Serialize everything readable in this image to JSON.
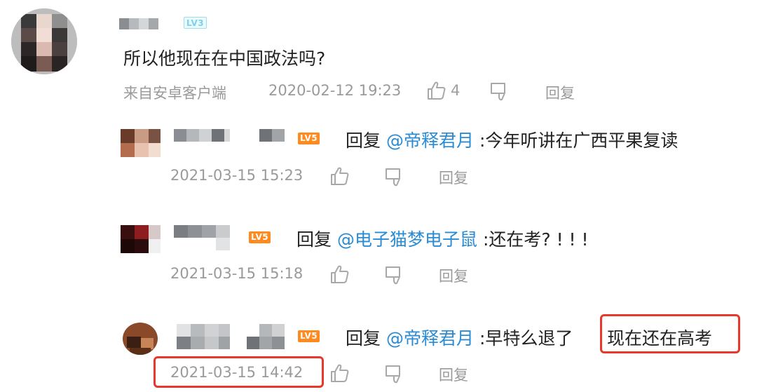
{
  "main_comment": {
    "level_badge": "LV3",
    "text": "所以他现在在中国政法吗?",
    "source": "来自安卓客户端",
    "time": "2020-02-12 19:23",
    "likes": "4",
    "reply_label": "回复"
  },
  "replies": [
    {
      "level_badge": "LV5",
      "reply_word": "回复",
      "mention": "@帝释君月",
      "text": ":今年听讲在广西平果复读",
      "time": "2021-03-15 15:23",
      "reply_label": "回复"
    },
    {
      "level_badge": "LV5",
      "reply_word": "回复",
      "mention": "@电子猫梦电子鼠",
      "text": ":还在考? ! ! !",
      "time": "2021-03-15 15:18",
      "reply_label": "回复"
    },
    {
      "level_badge": "LV5",
      "reply_word": "回复",
      "mention": "@帝释君月",
      "text_before": ":早特么退了",
      "text_highlight": "现在还在高考",
      "time": "2021-03-15 14:42",
      "reply_label": "回复"
    }
  ],
  "icons": {
    "like": "thumbs-up-icon",
    "dislike": "thumbs-down-icon"
  },
  "colors": {
    "mention": "#2a8bd5",
    "highlight_box": "#e8382c",
    "badge_orange": "#ff8a1f",
    "meta_gray": "#9a9a9a"
  }
}
